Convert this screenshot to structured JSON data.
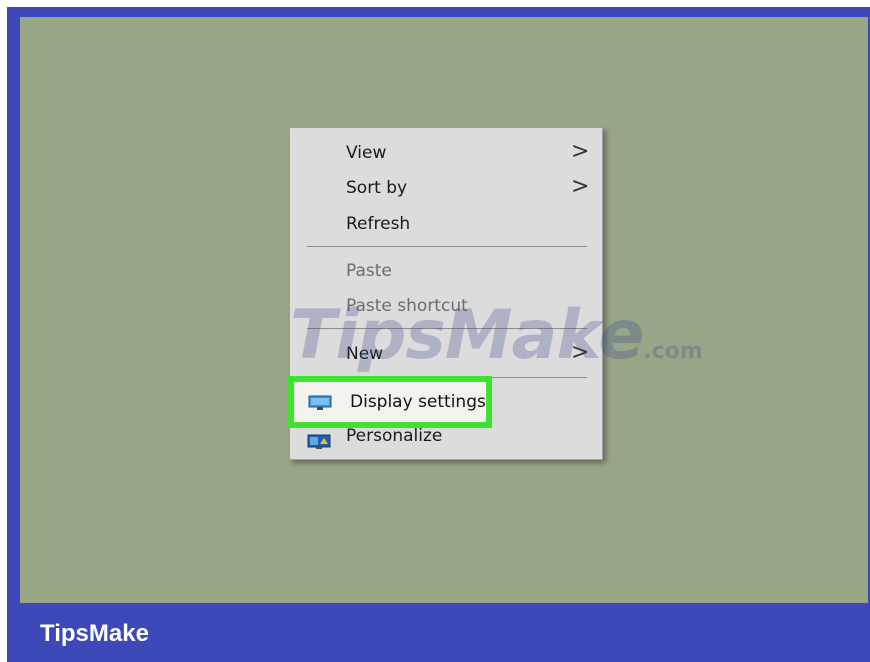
{
  "context_menu": {
    "items": [
      {
        "label": "View",
        "has_submenu": true,
        "disabled": false
      },
      {
        "label": "Sort by",
        "has_submenu": true,
        "disabled": false
      },
      {
        "label": "Refresh",
        "has_submenu": false,
        "disabled": false
      },
      {
        "label": "Paste",
        "has_submenu": false,
        "disabled": true
      },
      {
        "label": "Paste shortcut",
        "has_submenu": false,
        "disabled": true
      },
      {
        "label": "New",
        "has_submenu": true,
        "disabled": false
      },
      {
        "label": "Display settings",
        "has_submenu": false,
        "disabled": false,
        "icon": "monitor-icon",
        "highlighted": true
      },
      {
        "label": "Personalize",
        "has_submenu": false,
        "disabled": false,
        "icon": "personalize-icon"
      }
    ],
    "submenu_arrow": ">"
  },
  "watermark": {
    "text": "TipsMake",
    "suffix": ".com"
  },
  "footer": {
    "brand": "TipsMake"
  },
  "colors": {
    "frame": "#3d49b8",
    "desktop": "#97a687",
    "menu_bg": "#dcdcdc",
    "highlight_border": "#3fe22f"
  }
}
